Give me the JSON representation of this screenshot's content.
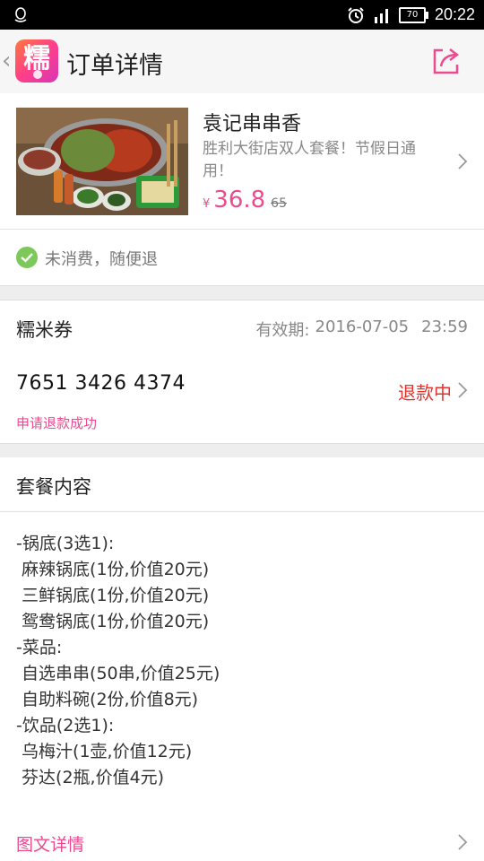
{
  "status_bar": {
    "time": "20:22",
    "battery": "70",
    "icons": [
      "qq-icon",
      "alarm-icon",
      "signal-icon",
      "battery-icon"
    ]
  },
  "header": {
    "back_icon": "back-chevron-icon",
    "logo_text": "糯",
    "title": "订单详情",
    "share_icon": "share-icon"
  },
  "product": {
    "name": "袁记串串香",
    "description": "胜利大街店双人套餐！节假日通用！",
    "currency": "¥",
    "price": "36.8",
    "original_price": "65"
  },
  "refund_note": {
    "text": "未消费，随便退"
  },
  "coupon": {
    "title": "糯米券",
    "validity_label": "有效期:",
    "validity_date": "2016-07-05",
    "validity_time": "23:59",
    "code": "7651 3426 4374",
    "status": "退款中",
    "status_note": "申请退款成功"
  },
  "package": {
    "title": "套餐内容",
    "items": [
      "-锅底(3选1):",
      " 麻辣锅底(1份,价值20元)",
      " 三鲜锅底(1份,价值20元)",
      " 鸳鸯锅底(1份,价值20元)",
      "-菜品:",
      " 自选串串(50串,价值25元)",
      " 自助料碗(2份,价值8元)",
      "-饮品(2选1):",
      " 乌梅汁(1壶,价值12元)",
      " 芬达(2瓶,价值4元)"
    ]
  },
  "detail_link": {
    "label": "图文详情"
  },
  "colors": {
    "accent": "#ec4b8e",
    "refund_red": "#e5322d",
    "check_green": "#7dc85a"
  }
}
